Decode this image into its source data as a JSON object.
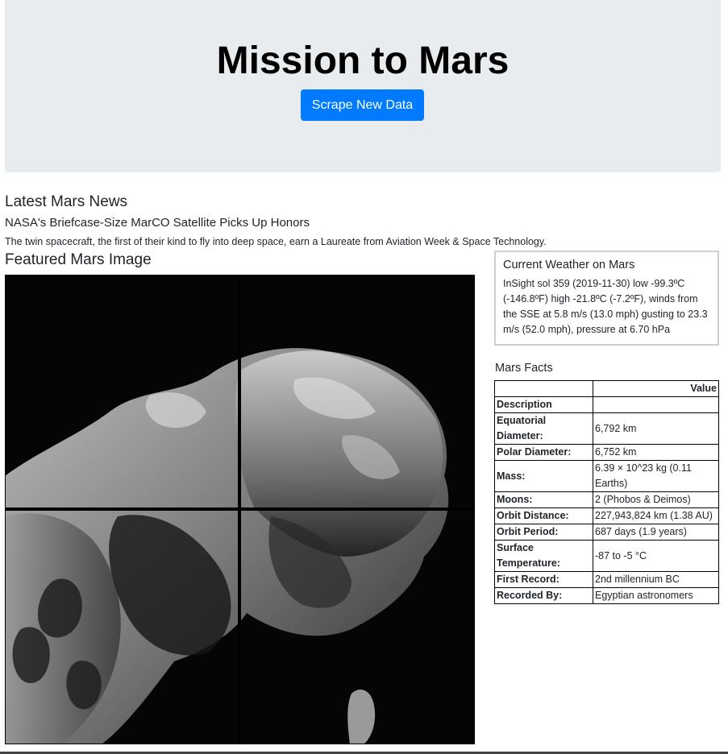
{
  "header": {
    "title": "Mission to Mars",
    "scrape_button_label": "Scrape New Data",
    "button_color": "#007bff",
    "background_color": "#e9ecef"
  },
  "news": {
    "heading": "Latest Mars News",
    "title": "NASA's Briefcase-Size MarCO Satellite Picks Up Honors",
    "teaser": "The twin spacecraft, the first of their kind to fly into deep space, earn a Laureate from Aviation Week & Space Technology."
  },
  "featured": {
    "heading": "Featured Mars Image"
  },
  "weather": {
    "heading": "Current Weather on Mars",
    "text": "InSight sol 359 (2019-11-30) low -99.3ºC (-146.8ºF) high -21.8ºC (-7.2ºF), winds from the SSE at 5.8 m/s (13.0 mph) gusting to 23.3 m/s (52.0 mph), pressure at 6.70 hPa"
  },
  "facts": {
    "heading": "Mars Facts",
    "value_header": "Value",
    "description_header": "Description",
    "rows": [
      {
        "label": "Equatorial Diameter:",
        "value": "6,792 km"
      },
      {
        "label": "Polar Diameter:",
        "value": "6,752 km"
      },
      {
        "label": "Mass:",
        "value": "6.39 × 10^23 kg (0.11 Earths)"
      },
      {
        "label": "Moons:",
        "value": "2 (Phobos & Deimos)"
      },
      {
        "label": "Orbit Distance:",
        "value": "227,943,824 km (1.38 AU)"
      },
      {
        "label": "Orbit Period:",
        "value": "687 days (1.9 years)"
      },
      {
        "label": "Surface Temperature:",
        "value": "-87 to -5 °C"
      },
      {
        "label": "First Record:",
        "value": "2nd millennium BC"
      },
      {
        "label": "Recorded By:",
        "value": "Egyptian astronomers"
      }
    ]
  }
}
